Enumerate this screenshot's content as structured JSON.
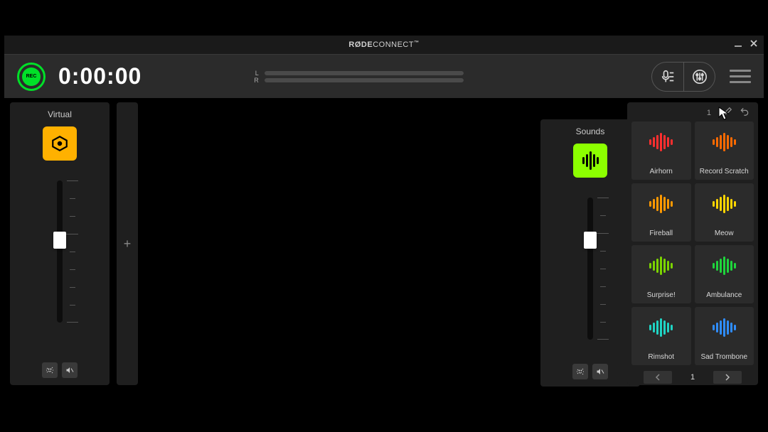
{
  "titlebar": {
    "brand": "RØDE",
    "product": "CONNECT",
    "tm": "™"
  },
  "header": {
    "rec_label": "REC",
    "timer": "0:00:00",
    "meter_left_label": "L",
    "meter_right_label": "R"
  },
  "channels": {
    "virtual": {
      "label": "Virtual"
    },
    "sounds": {
      "label": "Sounds"
    }
  },
  "add_symbol": "+",
  "sounds_panel": {
    "bank": "1",
    "pads": [
      {
        "label": "Airhorn",
        "color": "#ff2f2f"
      },
      {
        "label": "Record Scratch",
        "color": "#ff6a00"
      },
      {
        "label": "Fireball",
        "color": "#ff9900"
      },
      {
        "label": "Meow",
        "color": "#ffd500"
      },
      {
        "label": "Surprise!",
        "color": "#7bd400"
      },
      {
        "label": "Ambulance",
        "color": "#1fd43c"
      },
      {
        "label": "Rimshot",
        "color": "#1fd4c4"
      },
      {
        "label": "Sad Trombone",
        "color": "#2f8dff"
      }
    ],
    "pager_current": "1"
  }
}
